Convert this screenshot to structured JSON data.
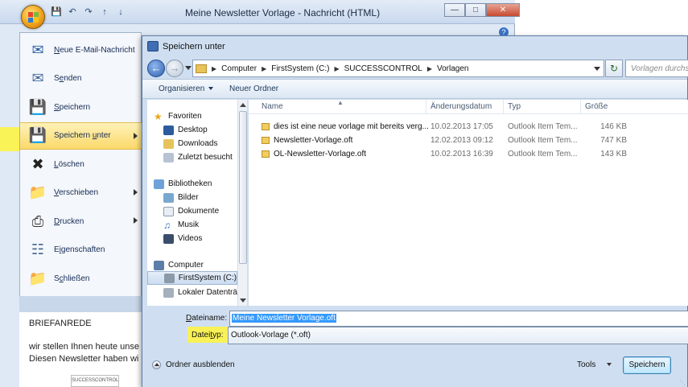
{
  "outlook": {
    "title": "Meine Newsletter Vorlage - Nachricht (HTML)",
    "qat_icons": [
      "save-icon",
      "undo-icon",
      "redo-icon",
      "up-icon",
      "down-icon"
    ],
    "menu": [
      {
        "label": "Neue E-Mail-Nachricht",
        "key": "N",
        "rest": "eue E-Mail-Nachricht",
        "icon": "new-mail-icon",
        "arrow": false
      },
      {
        "label": "Senden",
        "key": "e",
        "pre": "S",
        "rest": "nden",
        "icon": "send-icon",
        "arrow": false
      },
      {
        "label": "Speichern",
        "key": "S",
        "rest": "peichern",
        "icon": "save-icon",
        "arrow": false
      },
      {
        "label": "Speichern unter",
        "key": "u",
        "pre": "Speichern ",
        "rest": "nter",
        "icon": "save-as-icon",
        "arrow": true
      },
      {
        "label": "Löschen",
        "key": "L",
        "rest": "öschen",
        "icon": "delete-icon",
        "arrow": false
      },
      {
        "label": "Verschieben",
        "key": "V",
        "rest": "erschieben",
        "icon": "move-icon",
        "arrow": true
      },
      {
        "label": "Drucken",
        "key": "D",
        "rest": "rucken",
        "icon": "print-icon",
        "arrow": true
      },
      {
        "label": "Eigenschaften",
        "key": "i",
        "pre": "E",
        "rest": "genschaften",
        "icon": "properties-icon",
        "arrow": false
      },
      {
        "label": "Schließen",
        "key": "c",
        "pre": "S",
        "rest": "hließen",
        "icon": "close-folder-icon",
        "arrow": false
      }
    ],
    "body": {
      "greeting": "BRIEFANREDE",
      "line1": "wir stellen Ihnen heute unse",
      "line2": "Diesen Newsletter haben wi"
    },
    "logo_text": "SUCCESSCONTROL"
  },
  "dialog": {
    "title": "Speichern unter",
    "breadcrumb": [
      "Computer",
      "FirstSystem (C:)",
      "SUCCESSCONTROL",
      "Vorlagen"
    ],
    "search_placeholder": "Vorlagen durchsuchen",
    "toolbar": {
      "organize": "Organisieren",
      "new_folder": "Neuer Ordner"
    },
    "nav": {
      "favorites_header": "Favoriten",
      "favorites": [
        "Desktop",
        "Downloads",
        "Zuletzt besucht"
      ],
      "libraries_header": "Bibliotheken",
      "libraries": [
        "Bilder",
        "Dokumente",
        "Musik",
        "Videos"
      ],
      "computer_header": "Computer",
      "computer": [
        "FirstSystem (C:)",
        "Lokaler Datenträger"
      ]
    },
    "columns": {
      "name": "Name",
      "date": "Änderungsdatum",
      "type": "Typ",
      "size": "Größe"
    },
    "files": [
      {
        "name": "dies ist eine neue vorlage mit bereits verg...",
        "date": "10.02.2013 17:05",
        "type": "Outlook Item Tem...",
        "size": "146 KB"
      },
      {
        "name": "Newsletter-Vorlage.oft",
        "date": "12.02.2013 09:12",
        "type": "Outlook Item Tem...",
        "size": "747 KB"
      },
      {
        "name": "OL-Newsletter-Vorlage.oft",
        "date": "10.02.2013 16:39",
        "type": "Outlook Item Tem...",
        "size": "143 KB"
      }
    ],
    "filename_label": "Dateiname:",
    "filename_value": "Meine Newsletter Vorlage.oft",
    "filetype_label": "Dateityp:",
    "filetype_value": "Outlook-Vorlage (*.oft)",
    "hide_folders": "Ordner ausblenden",
    "tools": "Tools",
    "save": "Speichern"
  },
  "colors": {
    "highlight": "#fff53c",
    "selection": "#3399ff",
    "dialog_bg": "#cfdff1"
  }
}
